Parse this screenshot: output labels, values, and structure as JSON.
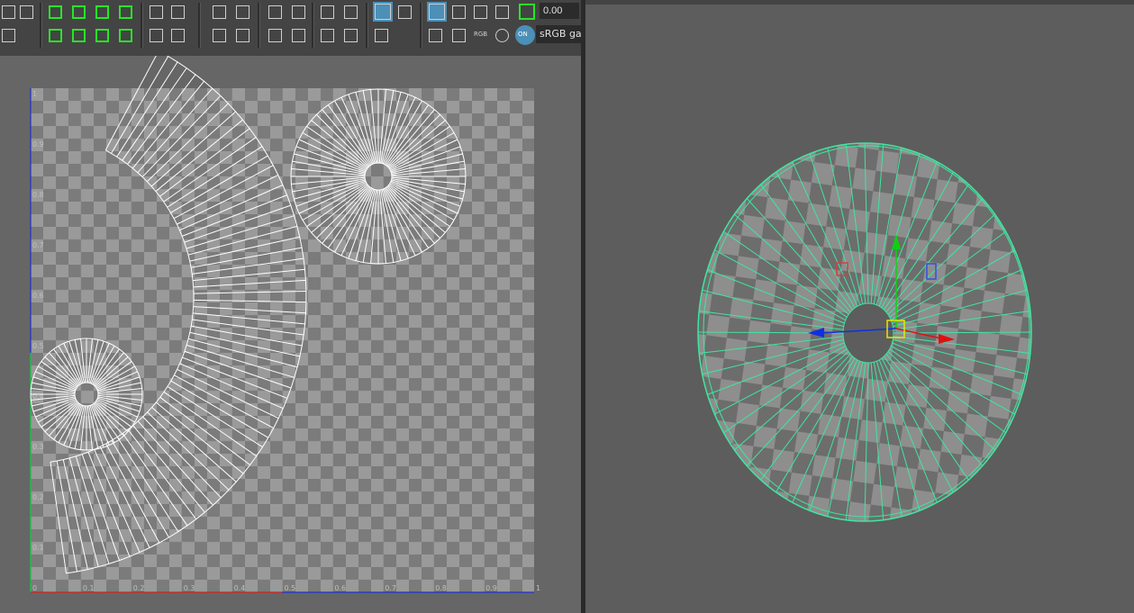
{
  "uv_toolbar": {
    "gamma_value": "0.00",
    "colorspace_label": "sRGB gar",
    "rgb_label": "RGB",
    "on_label": "ON"
  },
  "uv_grid": {
    "x_ticks": [
      "0",
      "0.1",
      "0.2",
      "0.3",
      "0.4",
      "0.5",
      "0.6",
      "0.7",
      "0.8",
      "0.9",
      "1"
    ],
    "y_ticks": [
      "1",
      "0.9",
      "0.8",
      "0.7",
      "0.6",
      "0.5",
      "0.4",
      "0.3",
      "0.2",
      "0.1"
    ]
  },
  "colors": {
    "accent_active": "#4c8fb7",
    "bracket_green": "#27e627",
    "wireframe_uv": "#ffffff",
    "wireframe_mesh": "#3fe6a0",
    "axis_u": "#d42020",
    "axis_v": "#2030d0",
    "gizmo_x": "#e01010",
    "gizmo_y": "#10d010",
    "gizmo_z": "#1030e0",
    "gizmo_center": "#e6e600"
  }
}
